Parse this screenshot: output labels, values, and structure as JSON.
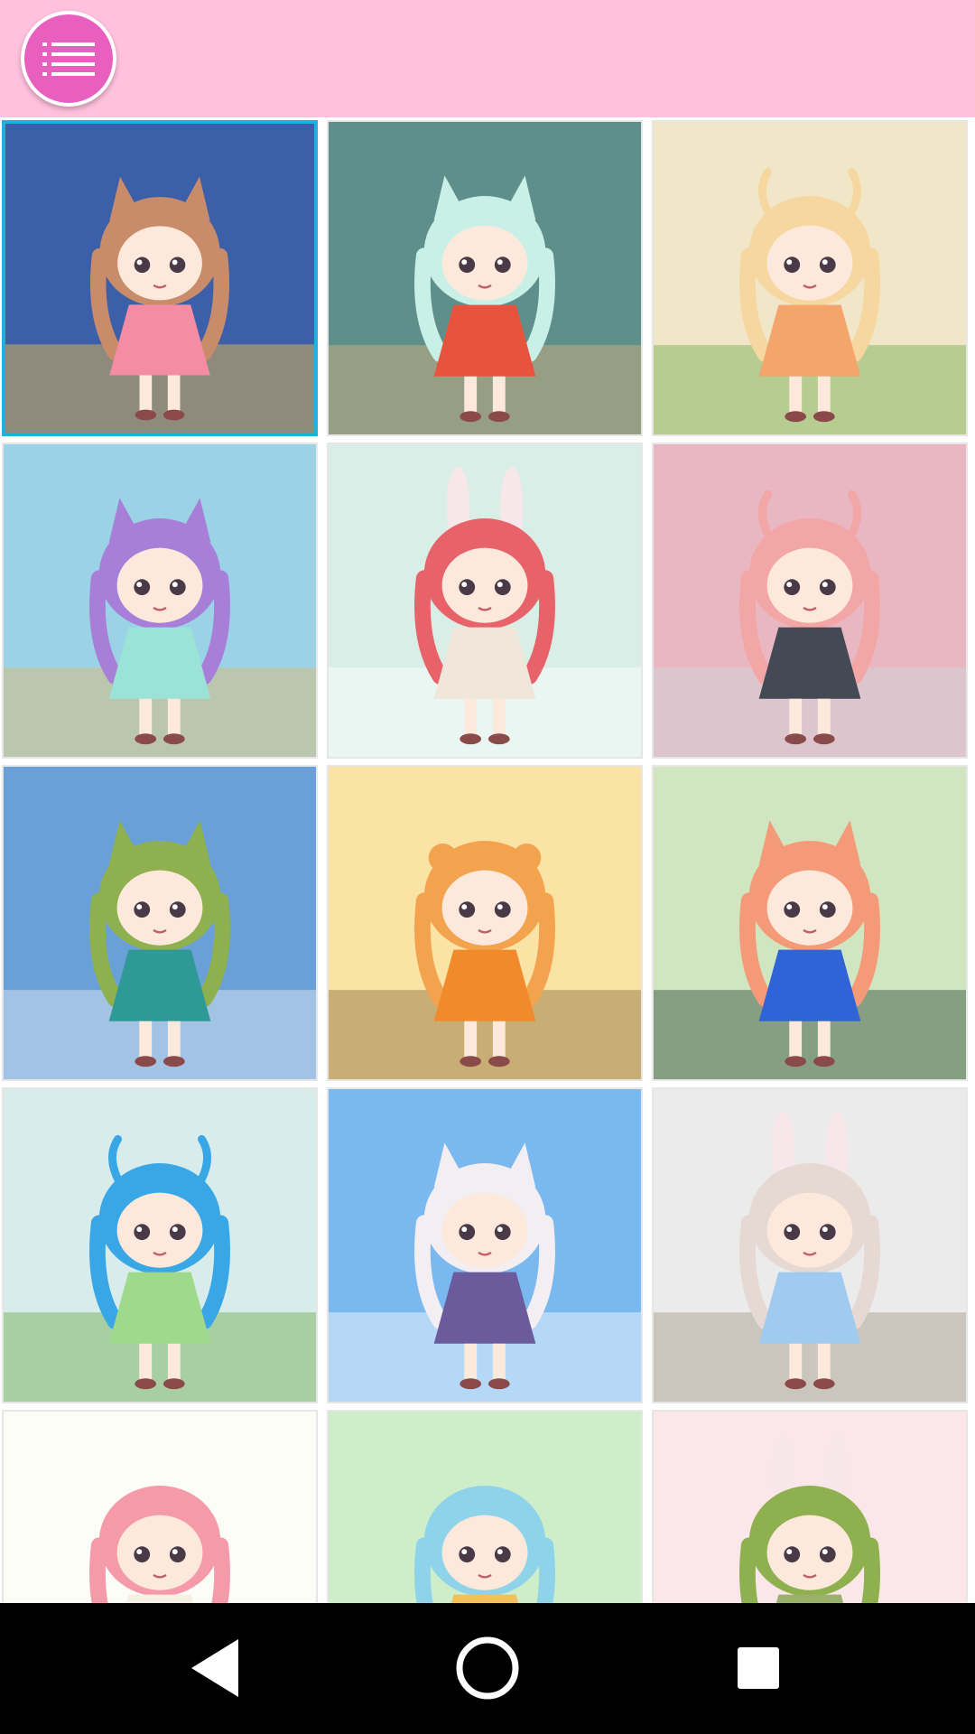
{
  "header": {
    "menu_icon": "hamburger-menu-icon",
    "accent_color": "#e85fbf",
    "bar_color": "#ffc1de"
  },
  "gallery": {
    "selected_index": 0,
    "items": [
      {
        "name": "character-1",
        "bg": "#3b5fa8",
        "hair": "#c98c6a",
        "outfit": "#f48da3",
        "accent": "#f5c24a",
        "ears": "cat"
      },
      {
        "name": "character-2",
        "bg": "#5f8f8a",
        "hair": "#c9f0e6",
        "outfit": "#e8533d",
        "accent": "#d9b37a",
        "ears": "cat"
      },
      {
        "name": "character-3",
        "bg": "#f1e6c8",
        "hair": "#f6d7a0",
        "outfit": "#f4a56b",
        "accent": "#6fae4c",
        "ears": "antler"
      },
      {
        "name": "character-4",
        "bg": "#9bd2e6",
        "hair": "#a77fd8",
        "outfit": "#9be3d6",
        "accent": "#e1b86b",
        "ears": "cat"
      },
      {
        "name": "character-5",
        "bg": "#d9eee6",
        "hair": "#e8626a",
        "outfit": "#f0e6da",
        "accent": "#ffffff",
        "ears": "bunny"
      },
      {
        "name": "character-6",
        "bg": "#e9b7c2",
        "hair": "#f2a6a6",
        "outfit": "#444a55",
        "accent": "#cfd6dc",
        "ears": "horn"
      },
      {
        "name": "character-7",
        "bg": "#6aa0d8",
        "hair": "#8fb04e",
        "outfit": "#2f9a95",
        "accent": "#e9eef3",
        "ears": "cat"
      },
      {
        "name": "character-8",
        "bg": "#fbe3a6",
        "hair": "#f3a34e",
        "outfit": "#f08a2a",
        "accent": "#8a6a3a",
        "ears": "bear"
      },
      {
        "name": "character-9",
        "bg": "#cfe6c0",
        "hair": "#f59a78",
        "outfit": "#2f63d6",
        "accent": "#2c4a3a",
        "ears": "cat"
      },
      {
        "name": "character-10",
        "bg": "#d8ecec",
        "hair": "#39a7e6",
        "outfit": "#9fd98b",
        "accent": "#6fae4c",
        "ears": "horn"
      },
      {
        "name": "character-11",
        "bg": "#7ab8f0",
        "hair": "#f2eef2",
        "outfit": "#6b5a9c",
        "accent": "#ffffff",
        "ears": "cat"
      },
      {
        "name": "character-12",
        "bg": "#ebebeb",
        "hair": "#e6d8d3",
        "outfit": "#9fcbf0",
        "accent": "#a59a86",
        "ears": "bunny"
      },
      {
        "name": "character-13",
        "bg": "#fdfdf8",
        "hair": "#f49aa8",
        "outfit": "#f6efe4",
        "accent": "#7fae5c",
        "ears": "none"
      },
      {
        "name": "character-14",
        "bg": "#cdeec9",
        "hair": "#8fd3ea",
        "outfit": "#f4c05a",
        "accent": "#f3d66a",
        "ears": "none"
      },
      {
        "name": "character-15",
        "bg": "#fbe6ea",
        "hair": "#8fb04e",
        "outfit": "#9bb06a",
        "accent": "#f7c59b",
        "ears": "bunny"
      }
    ]
  },
  "navigation": {
    "back_icon": "back-triangle-icon",
    "home_icon": "home-circle-icon",
    "recents_icon": "recents-square-icon"
  }
}
